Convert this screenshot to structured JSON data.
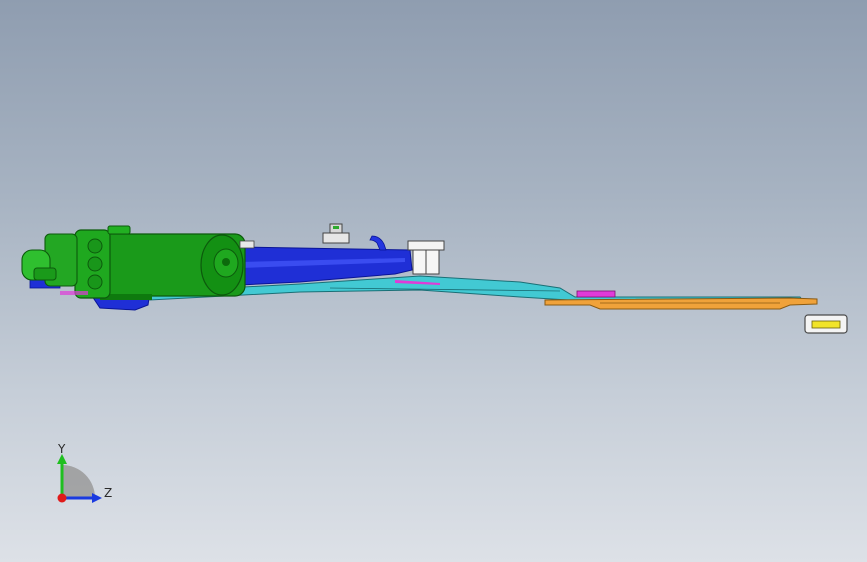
{
  "viewport": {
    "background_top": "#8f9db0",
    "background_bottom": "#dde1e7"
  },
  "model": {
    "colors": {
      "motor": "#1a9a1a",
      "motor_dark": "#0c6a0c",
      "bracket": "#1f2fd6",
      "bracket_dark": "#0a1596",
      "sheet": "#3fd6d6",
      "plate": "#f0a23a",
      "accent_magenta": "#e03ad8",
      "light_part": "#f2f2f2",
      "yellow_tab": "#f1e42a"
    }
  },
  "triad": {
    "y_label": "Y",
    "z_label": "Z",
    "y_color": "#1fbf1f",
    "z_color": "#1a3ae0",
    "x_color": "#e01a1a"
  }
}
